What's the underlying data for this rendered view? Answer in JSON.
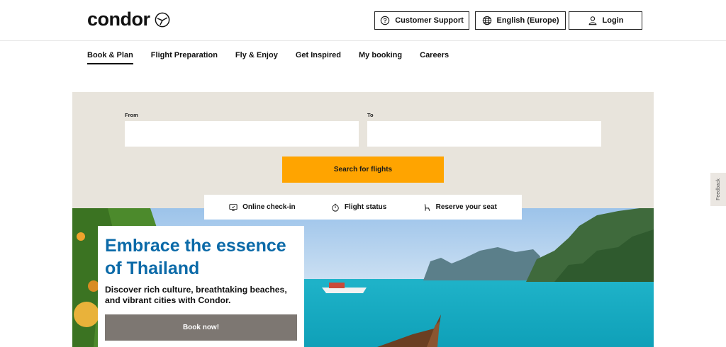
{
  "brand": {
    "name": "condor",
    "icon": "condor-bird-icon"
  },
  "header": {
    "support_label": "Customer Support",
    "language_label": "English (Europe)",
    "login_label": "Login"
  },
  "nav": {
    "items": [
      {
        "label": "Book & Plan",
        "active": true
      },
      {
        "label": "Flight Preparation"
      },
      {
        "label": "Fly & Enjoy"
      },
      {
        "label": "Get Inspired"
      },
      {
        "label": "My booking"
      },
      {
        "label": "Careers"
      }
    ]
  },
  "search": {
    "from_label": "From",
    "to_label": "To",
    "from_value": "",
    "to_value": "",
    "submit_label": "Search for flights"
  },
  "quick_links": [
    {
      "label": "Online check-in",
      "icon": "checkin-screen-icon"
    },
    {
      "label": "Flight status",
      "icon": "stopwatch-icon"
    },
    {
      "label": "Reserve your seat",
      "icon": "seat-icon"
    }
  ],
  "promo": {
    "title": "Embrace the essence of Thailand",
    "text": "Discover rich culture, breathtaking beaches, and vibrant cities with Condor.",
    "button_label": "Book now!"
  },
  "feedback_label": "Feedback",
  "colors": {
    "accent": "#ffa400",
    "title_blue": "#0b6aa8",
    "panel": "#e8e4dc",
    "promo_button": "#7d7772"
  }
}
